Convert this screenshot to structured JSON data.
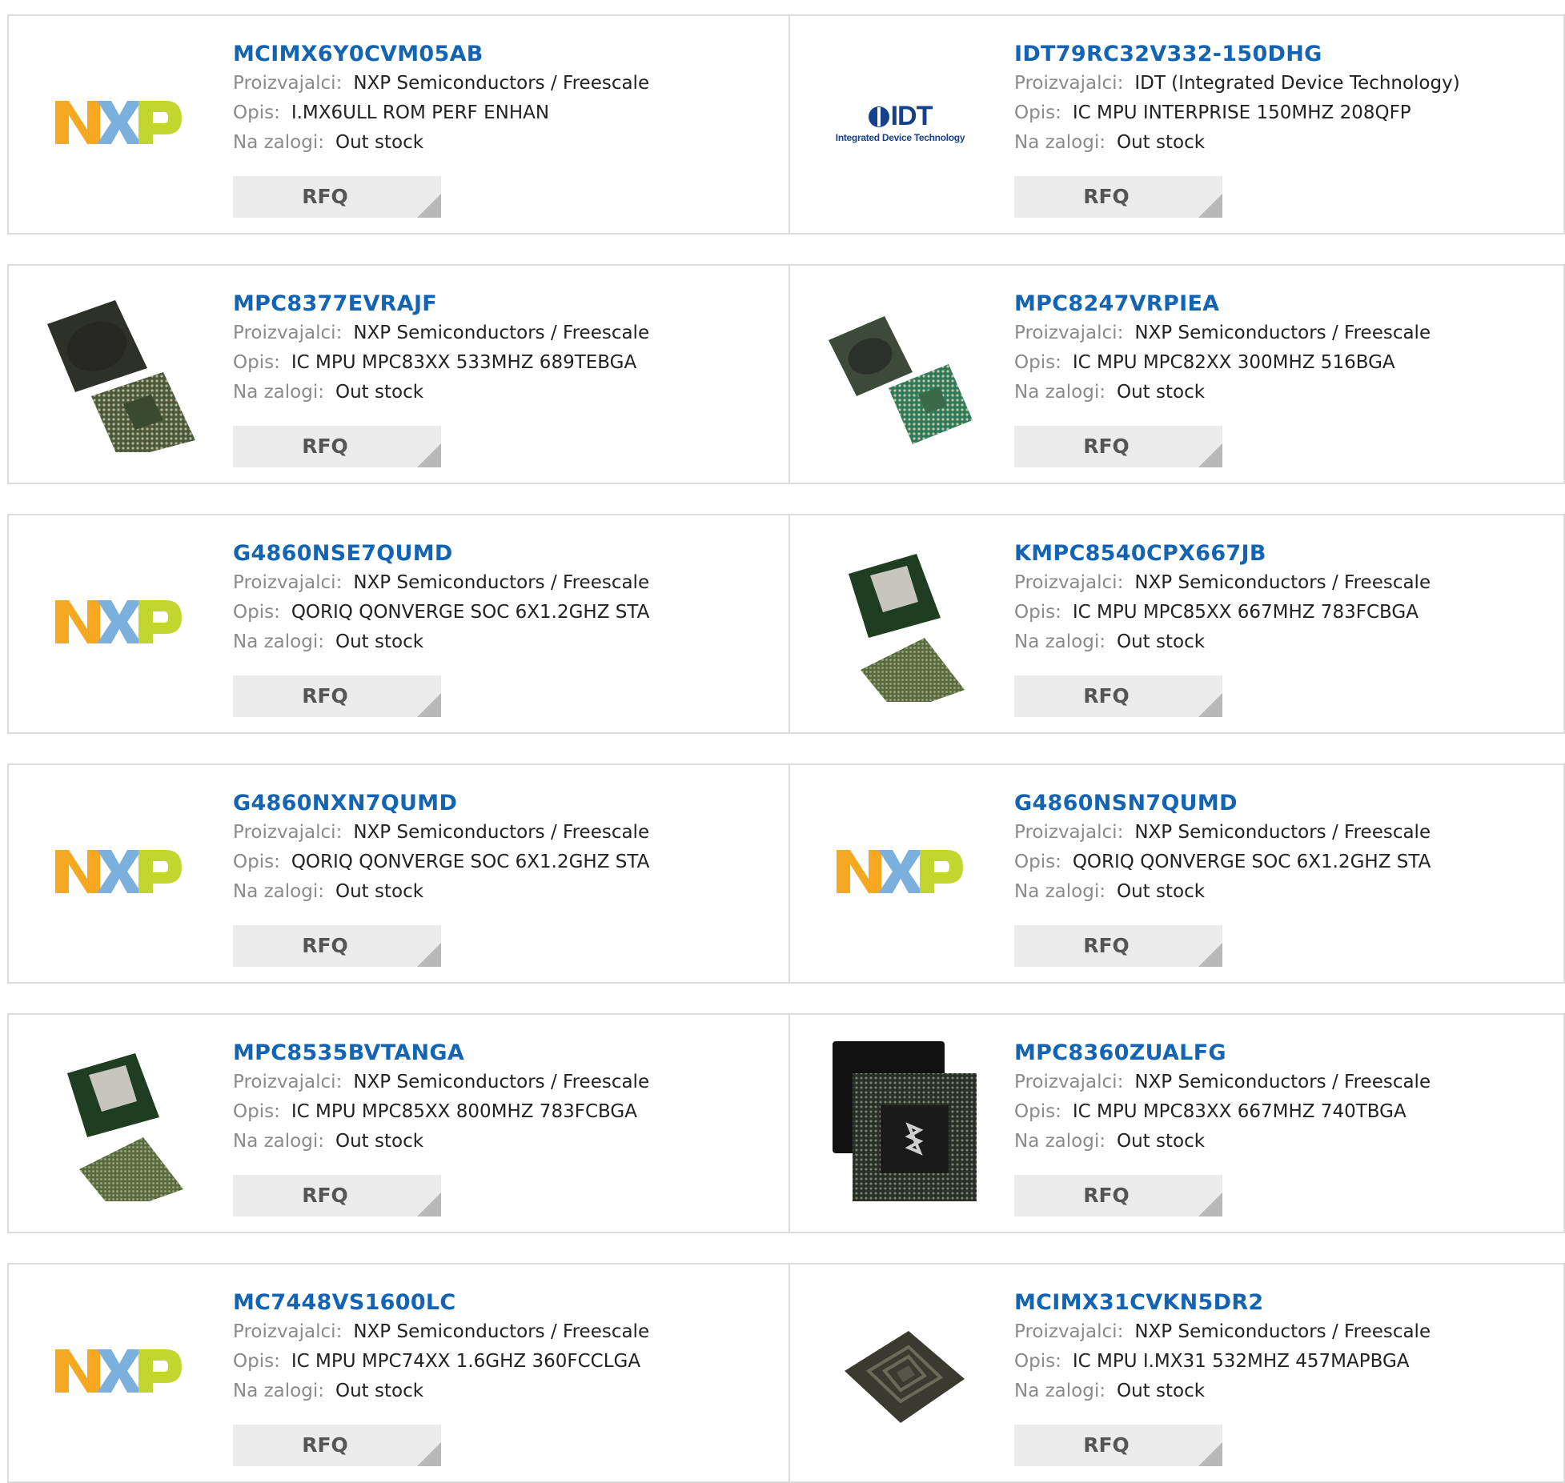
{
  "labels": {
    "manufacturer": "Proizvajalci:",
    "description": "Opis:",
    "stock": "Na zalogi:",
    "rfq": "RFQ"
  },
  "logos": {
    "nxp": "NXP",
    "idt_mark": "IDT",
    "idt_tagline": "Integrated Device Technology"
  },
  "colors": {
    "link": "#1464b4",
    "nxp_orange": "#f7a823",
    "nxp_blue": "#7bb0dc",
    "nxp_green": "#c1d72f",
    "idt_blue": "#14418c"
  },
  "products": [
    {
      "part": "MCIMX6Y0CVM05AB",
      "manufacturer": "NXP Semiconductors / Freescale",
      "description": "I.MX6ULL ROM PERF ENHAN",
      "stock": "Out stock",
      "image": "nxp-logo"
    },
    {
      "part": "IDT79RC32V332-150DHG",
      "manufacturer": "IDT (Integrated Device Technology)",
      "description": "IC MPU INTERPRISE 150MHZ 208QFP",
      "stock": "Out stock",
      "image": "idt-logo"
    },
    {
      "part": "MPC8377EVRAJF",
      "manufacturer": "NXP Semiconductors / Freescale",
      "description": "IC MPU MPC83XX 533MHZ 689TEBGA",
      "stock": "Out stock",
      "image": "bga-chip-dark"
    },
    {
      "part": "MPC8247VRPIEA",
      "manufacturer": "NXP Semiconductors / Freescale",
      "description": "IC MPU MPC82XX 300MHZ 516BGA",
      "stock": "Out stock",
      "image": "bga-chip-green"
    },
    {
      "part": "G4860NSE7QUMD",
      "manufacturer": "NXP Semiconductors / Freescale",
      "description": "QORIQ QONVERGE SOC 6X1.2GHZ STA",
      "stock": "Out stock",
      "image": "nxp-logo"
    },
    {
      "part": "KMPC8540CPX667JB",
      "manufacturer": "NXP Semiconductors / Freescale",
      "description": "IC MPU MPC85XX 667MHZ 783FCBGA",
      "stock": "Out stock",
      "image": "fcbga-chip"
    },
    {
      "part": "G4860NXN7QUMD",
      "manufacturer": "NXP Semiconductors / Freescale",
      "description": "QORIQ QONVERGE SOC 6X1.2GHZ STA",
      "stock": "Out stock",
      "image": "nxp-logo"
    },
    {
      "part": "G4860NSN7QUMD",
      "manufacturer": "NXP Semiconductors / Freescale",
      "description": "QORIQ QONVERGE SOC 6X1.2GHZ STA",
      "stock": "Out stock",
      "image": "nxp-logo"
    },
    {
      "part": "MPC8535BVTANGA",
      "manufacturer": "NXP Semiconductors / Freescale",
      "description": "IC MPU MPC85XX 800MHZ 783FCBGA",
      "stock": "Out stock",
      "image": "fcbga-chip"
    },
    {
      "part": "MPC8360ZUALFG",
      "manufacturer": "NXP Semiconductors / Freescale",
      "description": "IC MPU MPC83XX 667MHZ 740TBGA",
      "stock": "Out stock",
      "image": "tbga-chip-black"
    },
    {
      "part": "MC7448VS1600LC",
      "manufacturer": "NXP Semiconductors / Freescale",
      "description": "IC MPU MPC74XX 1.6GHZ 360FCCLGA",
      "stock": "Out stock",
      "image": "nxp-logo"
    },
    {
      "part": "MCIMX31CVKN5DR2",
      "manufacturer": "NXP Semiconductors / Freescale",
      "description": "IC MPU I.MX31 532MHZ 457MAPBGA",
      "stock": "Out stock",
      "image": "mapbga-chip"
    }
  ]
}
